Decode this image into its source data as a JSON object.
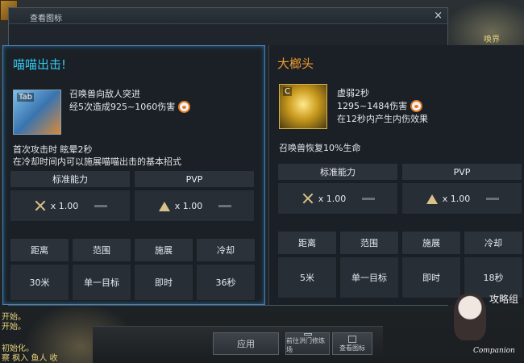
{
  "window": {
    "title": "查看图标",
    "close": "×"
  },
  "background": {
    "side_lines": [
      "开始。",
      "开始。",
      "初始化。",
      "察 枫入 鱼人 收"
    ],
    "top_right": "唤界"
  },
  "left": {
    "name": "喵喵出击!",
    "icon_key": "Tab",
    "desc1": "召唤兽向敌人突进",
    "desc2": "经5次造成925~1060伤害",
    "note1": "首次攻击时 眩晕2秒",
    "note2": "在冷却时间内可以施展喵喵出击的基本招式",
    "head_std": "标准能力",
    "head_pvp": "PVP",
    "std_mult": "x 1.00",
    "pvp_mult": "x 1.00",
    "attr_heads": [
      "距离",
      "范围",
      "施展",
      "冷却"
    ],
    "attr_values": [
      "30米",
      "单一目标",
      "即时",
      "36秒"
    ]
  },
  "right": {
    "name": "大榔头",
    "icon_key": "C",
    "desc1": "虚弱2秒",
    "desc2": "1295~1484伤害",
    "desc3": "在12秒内产生内伤效果",
    "note1": "召唤兽恢复10%生命",
    "head_std": "标准能力",
    "head_pvp": "PVP",
    "std_mult": "x 1.00",
    "pvp_mult": "x 1.00",
    "attr_heads": [
      "距离",
      "范围",
      "施展",
      "冷却"
    ],
    "attr_values": [
      "5米",
      "单一目标",
      "即时",
      "18秒"
    ]
  },
  "buttons": {
    "apply": "应用",
    "training": "前往洪门修炼场",
    "view_icons": "查看图标"
  },
  "watermark": {
    "calligraphy": "攻略组",
    "brand": "Companion"
  }
}
